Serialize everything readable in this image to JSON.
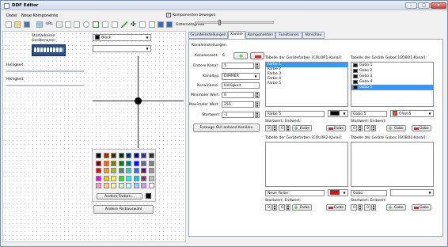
{
  "window": {
    "title": "DDF Editor",
    "minimize": "–",
    "maximize": "□",
    "close": "✕"
  },
  "menu": {
    "items": [
      "Datei",
      "Neue Komponente"
    ]
  },
  "toolbar": {
    "label": "Komponenten bewegen",
    "grid_label": "Gitternetzgröße",
    "checked": "✓",
    "icons": [
      "new-icon",
      "open-icon",
      "save-icon",
      "image-icon",
      "url-icon",
      "label-icon",
      "textbox-icon",
      "checkbox-icon",
      "radio-icon",
      "combobox-icon",
      "slider-icon",
      "line-icon",
      "crosshair-icon",
      "vslider-icon",
      "hslider-icon",
      "numeric-icon"
    ]
  },
  "left": {
    "startadresse_label": "Startadresse:",
    "geraetename_label": "Gerätename:",
    "color_combo_value": "Black",
    "second_combo_value": "",
    "helligkeit1": "Helligkeit",
    "helligkeit2": "Helligkeit",
    "andere_farben": "Andere Farben...",
    "andere_farbauswahl": "Andere Farbauswahl",
    "palette_colors": [
      "#000000",
      "#993300",
      "#333300",
      "#003300",
      "#003366",
      "#000080",
      "#333399",
      "#333333",
      "#800000",
      "#ff6600",
      "#808000",
      "#008000",
      "#008080",
      "#0000ff",
      "#666699",
      "#808080",
      "#ff0000",
      "#ff9900",
      "#99cc00",
      "#339966",
      "#33cccc",
      "#3366ff",
      "#800080",
      "#969696",
      "#ff00ff",
      "#ffcc00",
      "#ffff00",
      "#00ff00",
      "#00ffff",
      "#00ccff",
      "#993366",
      "#c0c0c0",
      "#ff99cc",
      "#ffcc99",
      "#ffff99",
      "#ccffcc",
      "#ccffff",
      "#99ccff",
      "#cc99ff",
      "#ffffff"
    ]
  },
  "tabs": [
    "Grundeinstellungen",
    "Kanäle",
    "Komponenten",
    "Funktionen",
    "Vorschau"
  ],
  "channel": {
    "section_title": "Kanaleinstellungen",
    "kanalanzahl_label": "Kanalanzahl:",
    "kanalanzahl_value": "6",
    "erster_kanal_label": "Erstere Kanal:",
    "erster_kanal_value": "1",
    "kanaltyp_label": "Kanaltyp:",
    "kanaltyp_value": "DIMMER",
    "kanalname_label": "Kanalname:",
    "kanalname_value": "Helligkeit",
    "min_label": "Minimaler Wert:",
    "min_value": "0",
    "max_label": "Maximaler Wert:",
    "max_value": "255",
    "start_label": "Startwert:",
    "start_value": "-1",
    "generate_button": "Erzeuge GUI anhand Kanälen"
  },
  "color1": {
    "title": "Tabelle der Gerätefarben [COLOR1-Kanal]:",
    "items": [
      "Farbe 1",
      "Farbe 2",
      "Farbe 3",
      "Farbe 4",
      "Farbe 5"
    ],
    "selected_index": 0,
    "input_value": "Farbe 5",
    "swatch_color": "#000000",
    "range_label": "Startwert: Endwert:",
    "start": "0",
    "end": "0",
    "add_label": "Farbe",
    "remove_label": "Farbe"
  },
  "gobo1": {
    "title": "Tabelle der Geräte Gobos [GOBO1-Kanal]:",
    "items": [
      "Gobo 1",
      "Gobo 2",
      "Gobo 3",
      "Gobo 4",
      "Gobo 5"
    ],
    "selected_index": 4,
    "input_value": "Gobo 5",
    "combo_value": "Glass5",
    "range_label": "Startwert: Endwert:",
    "start": "0",
    "end": "0",
    "add_label": "Gobo",
    "remove_label": "Gobo"
  },
  "color2": {
    "title": "Tabelle der Gerätefarben [COLOR2-Kanal]:",
    "input_value": "Neue Farbe:",
    "swatch_color": "#ff0000",
    "range_label": "Startwert: Endwert:",
    "start": "0",
    "end": "0",
    "add_label": "Farbe",
    "remove_label": "Farbe"
  },
  "gobo2": {
    "title": "Tabelle der Geräte Gobos [GOBO2-Kanal]:",
    "input_value": "Gobo",
    "combo_value": "",
    "range_label": "Startwert: Endwert:",
    "start": "0",
    "end": "0",
    "add_label": "Gobo",
    "remove_label": "Gobo"
  }
}
